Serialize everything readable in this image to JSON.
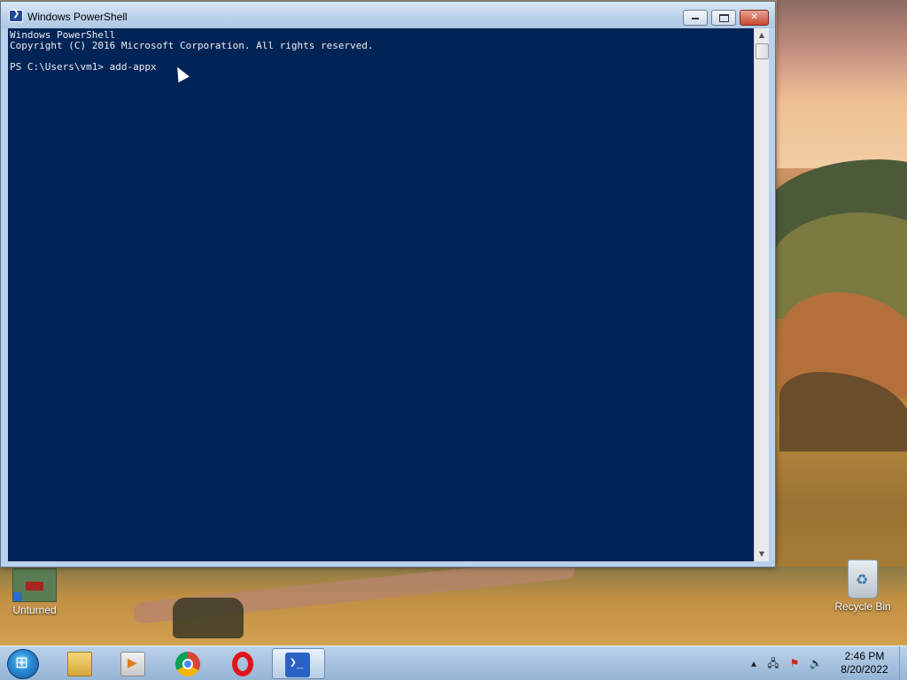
{
  "window": {
    "title": "Windows PowerShell",
    "minimize_icon": "minimize-icon",
    "maximize_icon": "maximize-icon",
    "close_icon": "close-icon",
    "close_label": "✕"
  },
  "console": {
    "text": "Windows PowerShell\nCopyright (C) 2016 Microsoft Corporation. All rights reserved.\n\nPS C:\\Users\\vm1> add-appx",
    "background_color": "#012456",
    "text_color": "#eeedf0"
  },
  "desktop": {
    "icons": [
      {
        "label": "Unturned",
        "icon": "unturned-game-icon"
      },
      {
        "label": "Recycle Bin",
        "icon": "recycle-bin-icon"
      }
    ]
  },
  "taskbar": {
    "start_icon": "windows-start-orb-icon",
    "pinned": [
      {
        "name": "file-explorer",
        "icon": "folder-icon"
      },
      {
        "name": "windows-media-player",
        "icon": "media-player-icon"
      },
      {
        "name": "google-chrome",
        "icon": "chrome-icon"
      },
      {
        "name": "opera",
        "icon": "opera-icon"
      },
      {
        "name": "windows-powershell",
        "icon": "powershell-icon",
        "active": true
      }
    ],
    "tray": {
      "show_hidden_icon": "▴",
      "network_icon": "network-icon",
      "action_center_icon": "flag-icon",
      "volume_icon": "speaker-icon"
    },
    "clock": {
      "time": "2:46 PM",
      "date": "8/20/2022"
    }
  }
}
